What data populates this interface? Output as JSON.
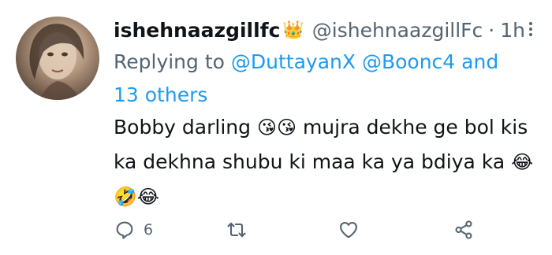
{
  "tweet": {
    "display_name": "ishehnaazgillfc",
    "name_emoji": "👑",
    "handle": "@ishehnaazgillFc",
    "separator": "·",
    "time": "1h",
    "reply_prefix": "Replying to",
    "reply_user1": "@DuttayanX",
    "reply_user2": "@Boonc4",
    "reply_others": "and 13 others",
    "text_part1": "Bobby darling",
    "emoji1": "😘😘",
    "text_part2": "mujra dekhe ge bol kis ka dekhna shubu ki maa ka ya bdiya ka",
    "emoji2": "😂",
    "emoji3": "🤣😂"
  },
  "actions": {
    "reply_count": "6",
    "retweet_count": "",
    "like_count": ""
  },
  "icons": [
    "more-icon",
    "reply-icon",
    "retweet-icon",
    "like-icon",
    "share-icon"
  ],
  "colors": {
    "link": "#1d9bf0",
    "muted": "#536471",
    "text": "#0f1419"
  }
}
